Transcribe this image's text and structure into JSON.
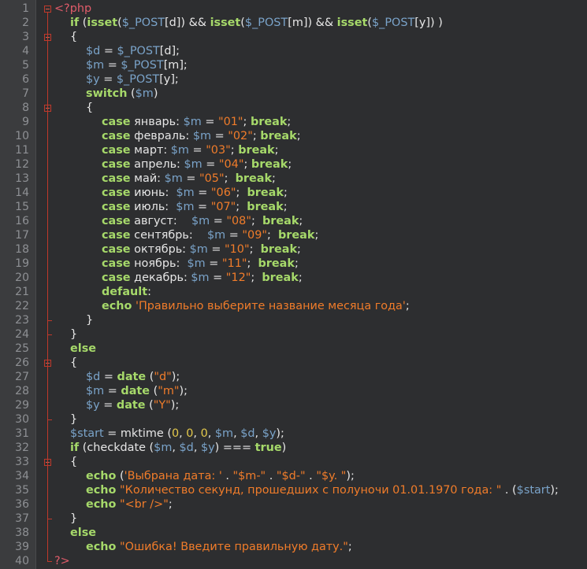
{
  "colors": {
    "background": "#2d2e30",
    "gutter": "#3b3c3e",
    "line_number": "#8e9094",
    "keyword": "#a6d96a",
    "variable": "#7aa3c9",
    "string": "#f07c2a",
    "number": "#e3c84b",
    "php_tag": "#e05c6a",
    "fold_marker": "#c0392b"
  },
  "editor": {
    "lines": [
      {
        "n": "1",
        "indent": 0,
        "fold": "open",
        "tokens": [
          [
            "tag",
            "<?php"
          ]
        ]
      },
      {
        "n": "2",
        "indent": 1,
        "tokens": [
          [
            "kw",
            "if"
          ],
          [
            "txt",
            " ("
          ],
          [
            "kw",
            "isset"
          ],
          [
            "txt",
            "("
          ],
          [
            "var",
            "$_POST"
          ],
          [
            "txt",
            "[d]) && "
          ],
          [
            "kw",
            "isset"
          ],
          [
            "txt",
            "("
          ],
          [
            "var",
            "$_POST"
          ],
          [
            "txt",
            "[m]) && "
          ],
          [
            "kw",
            "isset"
          ],
          [
            "txt",
            "("
          ],
          [
            "var",
            "$_POST"
          ],
          [
            "txt",
            "[y]) )"
          ]
        ]
      },
      {
        "n": "3",
        "indent": 1,
        "fold": "open",
        "tokens": [
          [
            "txt",
            "{"
          ]
        ]
      },
      {
        "n": "4",
        "indent": 2,
        "tokens": [
          [
            "var",
            "$d"
          ],
          [
            "txt",
            " = "
          ],
          [
            "var",
            "$_POST"
          ],
          [
            "txt",
            "[d];"
          ]
        ]
      },
      {
        "n": "5",
        "indent": 2,
        "tokens": [
          [
            "var",
            "$m"
          ],
          [
            "txt",
            " = "
          ],
          [
            "var",
            "$_POST"
          ],
          [
            "txt",
            "[m];"
          ]
        ]
      },
      {
        "n": "6",
        "indent": 2,
        "tokens": [
          [
            "var",
            "$y"
          ],
          [
            "txt",
            " = "
          ],
          [
            "var",
            "$_POST"
          ],
          [
            "txt",
            "[y];"
          ]
        ]
      },
      {
        "n": "7",
        "indent": 2,
        "tokens": [
          [
            "kw",
            "switch"
          ],
          [
            "txt",
            " ("
          ],
          [
            "var",
            "$m"
          ],
          [
            "txt",
            ")"
          ]
        ]
      },
      {
        "n": "8",
        "indent": 2,
        "fold": "open",
        "tokens": [
          [
            "txt",
            "{"
          ]
        ]
      },
      {
        "n": "9",
        "indent": 3,
        "tokens": [
          [
            "kw",
            "case"
          ],
          [
            "txt",
            " январь: "
          ],
          [
            "var",
            "$m"
          ],
          [
            "txt",
            " = "
          ],
          [
            "str",
            "\"01\""
          ],
          [
            "txt",
            "; "
          ],
          [
            "kw",
            "break"
          ],
          [
            "txt",
            ";"
          ]
        ]
      },
      {
        "n": "10",
        "indent": 3,
        "tokens": [
          [
            "kw",
            "case"
          ],
          [
            "txt",
            " февраль: "
          ],
          [
            "var",
            "$m"
          ],
          [
            "txt",
            " = "
          ],
          [
            "str",
            "\"02\""
          ],
          [
            "txt",
            "; "
          ],
          [
            "kw",
            "break"
          ],
          [
            "txt",
            ";"
          ]
        ]
      },
      {
        "n": "11",
        "indent": 3,
        "tokens": [
          [
            "kw",
            "case"
          ],
          [
            "txt",
            " март: "
          ],
          [
            "var",
            "$m"
          ],
          [
            "txt",
            " = "
          ],
          [
            "str",
            "\"03\""
          ],
          [
            "txt",
            "; "
          ],
          [
            "kw",
            "break"
          ],
          [
            "txt",
            ";"
          ]
        ]
      },
      {
        "n": "12",
        "indent": 3,
        "tokens": [
          [
            "kw",
            "case"
          ],
          [
            "txt",
            " апрель: "
          ],
          [
            "var",
            "$m"
          ],
          [
            "txt",
            " = "
          ],
          [
            "str",
            "\"04\""
          ],
          [
            "txt",
            "; "
          ],
          [
            "kw",
            "break"
          ],
          [
            "txt",
            ";"
          ]
        ]
      },
      {
        "n": "13",
        "indent": 3,
        "tokens": [
          [
            "kw",
            "case"
          ],
          [
            "txt",
            " май: "
          ],
          [
            "var",
            "$m"
          ],
          [
            "txt",
            " = "
          ],
          [
            "str",
            "\"05\""
          ],
          [
            "txt",
            ";  "
          ],
          [
            "kw",
            "break"
          ],
          [
            "txt",
            ";"
          ]
        ]
      },
      {
        "n": "14",
        "indent": 3,
        "tokens": [
          [
            "kw",
            "case"
          ],
          [
            "txt",
            " июнь:  "
          ],
          [
            "var",
            "$m"
          ],
          [
            "txt",
            " = "
          ],
          [
            "str",
            "\"06\""
          ],
          [
            "txt",
            ";  "
          ],
          [
            "kw",
            "break"
          ],
          [
            "txt",
            ";"
          ]
        ]
      },
      {
        "n": "15",
        "indent": 3,
        "tokens": [
          [
            "kw",
            "case"
          ],
          [
            "txt",
            " июль:  "
          ],
          [
            "var",
            "$m"
          ],
          [
            "txt",
            " = "
          ],
          [
            "str",
            "\"07\""
          ],
          [
            "txt",
            ";  "
          ],
          [
            "kw",
            "break"
          ],
          [
            "txt",
            ";"
          ]
        ]
      },
      {
        "n": "16",
        "indent": 3,
        "tokens": [
          [
            "kw",
            "case"
          ],
          [
            "txt",
            " август:    "
          ],
          [
            "var",
            "$m"
          ],
          [
            "txt",
            " = "
          ],
          [
            "str",
            "\"08\""
          ],
          [
            "txt",
            ";  "
          ],
          [
            "kw",
            "break"
          ],
          [
            "txt",
            ";"
          ]
        ]
      },
      {
        "n": "17",
        "indent": 3,
        "tokens": [
          [
            "kw",
            "case"
          ],
          [
            "txt",
            " сентябрь:    "
          ],
          [
            "var",
            "$m"
          ],
          [
            "txt",
            " = "
          ],
          [
            "str",
            "\"09\""
          ],
          [
            "txt",
            ";  "
          ],
          [
            "kw",
            "break"
          ],
          [
            "txt",
            ";"
          ]
        ]
      },
      {
        "n": "18",
        "indent": 3,
        "tokens": [
          [
            "kw",
            "case"
          ],
          [
            "txt",
            " октябрь: "
          ],
          [
            "var",
            "$m"
          ],
          [
            "txt",
            " = "
          ],
          [
            "str",
            "\"10\""
          ],
          [
            "txt",
            ";  "
          ],
          [
            "kw",
            "break"
          ],
          [
            "txt",
            ";"
          ]
        ]
      },
      {
        "n": "19",
        "indent": 3,
        "tokens": [
          [
            "kw",
            "case"
          ],
          [
            "txt",
            " ноябрь:  "
          ],
          [
            "var",
            "$m"
          ],
          [
            "txt",
            " = "
          ],
          [
            "str",
            "\"11\""
          ],
          [
            "txt",
            ";  "
          ],
          [
            "kw",
            "break"
          ],
          [
            "txt",
            ";"
          ]
        ]
      },
      {
        "n": "20",
        "indent": 3,
        "tokens": [
          [
            "kw",
            "case"
          ],
          [
            "txt",
            " декабрь: "
          ],
          [
            "var",
            "$m"
          ],
          [
            "txt",
            " = "
          ],
          [
            "str",
            "\"12\""
          ],
          [
            "txt",
            ";  "
          ],
          [
            "kw",
            "break"
          ],
          [
            "txt",
            ";"
          ]
        ]
      },
      {
        "n": "21",
        "indent": 3,
        "tokens": [
          [
            "kw",
            "default"
          ],
          [
            "txt",
            ":"
          ]
        ]
      },
      {
        "n": "22",
        "indent": 3,
        "tokens": [
          [
            "kw",
            "echo"
          ],
          [
            "txt",
            " "
          ],
          [
            "str",
            "'Правильно выберите название месяца года'"
          ],
          [
            "txt",
            ";"
          ]
        ]
      },
      {
        "n": "23",
        "indent": 2,
        "fold": "end",
        "tokens": [
          [
            "txt",
            "}"
          ]
        ]
      },
      {
        "n": "24",
        "indent": 1,
        "fold": "end",
        "tokens": [
          [
            "txt",
            "}"
          ]
        ]
      },
      {
        "n": "25",
        "indent": 1,
        "tokens": [
          [
            "kw",
            "else"
          ]
        ]
      },
      {
        "n": "26",
        "indent": 1,
        "fold": "open",
        "tokens": [
          [
            "txt",
            "{"
          ]
        ]
      },
      {
        "n": "27",
        "indent": 2,
        "tokens": [
          [
            "var",
            "$d"
          ],
          [
            "txt",
            " = "
          ],
          [
            "kw",
            "date"
          ],
          [
            "txt",
            " ("
          ],
          [
            "str",
            "\"d\""
          ],
          [
            "txt",
            ");"
          ]
        ]
      },
      {
        "n": "28",
        "indent": 2,
        "tokens": [
          [
            "var",
            "$m"
          ],
          [
            "txt",
            " = "
          ],
          [
            "kw",
            "date"
          ],
          [
            "txt",
            " ("
          ],
          [
            "str",
            "\"m\""
          ],
          [
            "txt",
            ");"
          ]
        ]
      },
      {
        "n": "29",
        "indent": 2,
        "tokens": [
          [
            "var",
            "$y"
          ],
          [
            "txt",
            " = "
          ],
          [
            "kw",
            "date"
          ],
          [
            "txt",
            " ("
          ],
          [
            "str",
            "\"Y\""
          ],
          [
            "txt",
            ");"
          ]
        ]
      },
      {
        "n": "30",
        "indent": 1,
        "fold": "end",
        "tokens": [
          [
            "txt",
            "}"
          ]
        ]
      },
      {
        "n": "31",
        "indent": 1,
        "tokens": [
          [
            "var",
            "$start"
          ],
          [
            "txt",
            " = mktime ("
          ],
          [
            "num",
            "0"
          ],
          [
            "txt",
            ", "
          ],
          [
            "num",
            "0"
          ],
          [
            "txt",
            ", "
          ],
          [
            "num",
            "0"
          ],
          [
            "txt",
            ", "
          ],
          [
            "var",
            "$m"
          ],
          [
            "txt",
            ", "
          ],
          [
            "var",
            "$d"
          ],
          [
            "txt",
            ", "
          ],
          [
            "var",
            "$y"
          ],
          [
            "txt",
            ");"
          ]
        ]
      },
      {
        "n": "32",
        "indent": 1,
        "tokens": [
          [
            "kw",
            "if"
          ],
          [
            "txt",
            " (checkdate ("
          ],
          [
            "var",
            "$m"
          ],
          [
            "txt",
            ", "
          ],
          [
            "var",
            "$d"
          ],
          [
            "txt",
            ", "
          ],
          [
            "var",
            "$y"
          ],
          [
            "txt",
            ") === "
          ],
          [
            "kw",
            "true"
          ],
          [
            "txt",
            ")"
          ]
        ]
      },
      {
        "n": "33",
        "indent": 1,
        "fold": "open",
        "tokens": [
          [
            "txt",
            "{"
          ]
        ]
      },
      {
        "n": "34",
        "indent": 2,
        "tokens": [
          [
            "kw",
            "echo"
          ],
          [
            "txt",
            " ("
          ],
          [
            "str",
            "'Выбрана дата: '"
          ],
          [
            "txt",
            " . "
          ],
          [
            "str",
            "\"$m-\""
          ],
          [
            "txt",
            " . "
          ],
          [
            "str",
            "\"$d-\""
          ],
          [
            "txt",
            " . "
          ],
          [
            "str",
            "\"$y. \""
          ],
          [
            "txt",
            ");"
          ]
        ]
      },
      {
        "n": "35",
        "indent": 2,
        "tokens": [
          [
            "kw",
            "echo"
          ],
          [
            "txt",
            " "
          ],
          [
            "str",
            "\"Количество секунд, прошедших с полуночи 01.01.1970 года: \""
          ],
          [
            "txt",
            " . ("
          ],
          [
            "var",
            "$start"
          ],
          [
            "txt",
            ");"
          ]
        ]
      },
      {
        "n": "36",
        "indent": 2,
        "tokens": [
          [
            "kw",
            "echo"
          ],
          [
            "txt",
            " "
          ],
          [
            "str",
            "\"<br />\""
          ],
          [
            "txt",
            ";"
          ]
        ]
      },
      {
        "n": "37",
        "indent": 1,
        "fold": "end",
        "tokens": [
          [
            "txt",
            "}"
          ]
        ]
      },
      {
        "n": "38",
        "indent": 1,
        "tokens": [
          [
            "kw",
            "else"
          ]
        ]
      },
      {
        "n": "39",
        "indent": 2,
        "tokens": [
          [
            "kw",
            "echo"
          ],
          [
            "txt",
            " "
          ],
          [
            "str",
            "\"Ошибка! Введите правильную дату.\""
          ],
          [
            "txt",
            ";"
          ]
        ]
      },
      {
        "n": "40",
        "indent": 0,
        "fold": "end",
        "tokens": [
          [
            "tag",
            "?>"
          ]
        ]
      }
    ]
  }
}
